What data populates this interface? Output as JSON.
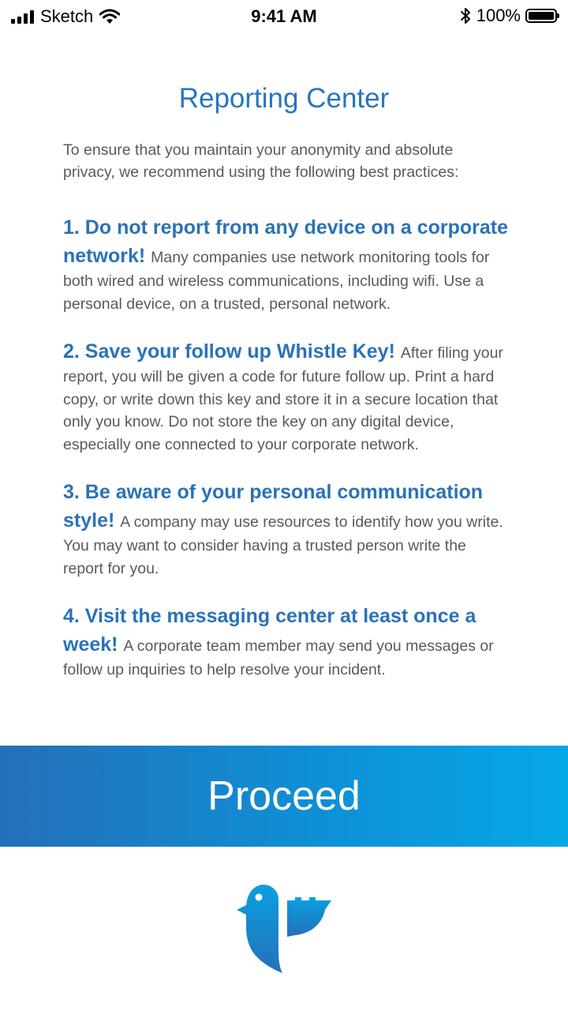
{
  "status_bar": {
    "carrier": "Sketch",
    "time": "9:41 AM",
    "battery": "100%"
  },
  "page": {
    "title": "Reporting Center",
    "intro": "To ensure that you maintain your anonymity and absolute privacy, we recommend using the following best practices:"
  },
  "practices": [
    {
      "heading": "1. Do not report from any device on a corporate network!",
      "body": "Many companies use network monitoring tools for both wired and wireless communications, including wifi. Use a personal device, on a trusted, personal network."
    },
    {
      "heading": "2. Save your follow up Whistle Key!",
      "body": "After filing your report, you will be given a code for future follow up. Print a hard copy, or write down this key and store it in a secure location that only you know. Do not store the key on any digital device, especially one connected to your corporate network."
    },
    {
      "heading": "3. Be aware of your personal communication style!",
      "body": "A company may use resources to identify how you write. You may want to consider having a trusted person write the report for you."
    },
    {
      "heading": "4. Visit the messaging center at least once a week!",
      "body": "A corporate team member may send you messages or follow up inquiries to help resolve your incident."
    }
  ],
  "proceed_label": "Proceed",
  "colors": {
    "accent": "#2775bf",
    "gradient_start": "#2470b8",
    "gradient_end": "#05a8e6",
    "body_text": "#555b61"
  },
  "icons": {
    "signal": "cellular-signal-icon",
    "wifi": "wifi-icon",
    "bluetooth": "bluetooth-icon",
    "battery": "battery-icon",
    "logo": "bird-logo-icon"
  }
}
